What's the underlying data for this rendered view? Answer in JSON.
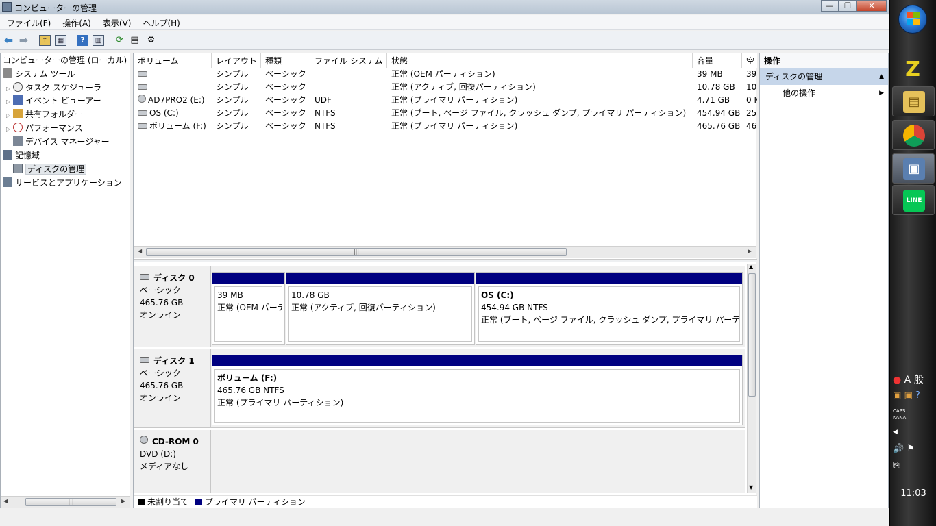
{
  "window": {
    "title": "コンピューターの管理",
    "controls": {
      "minimize": "—",
      "maximize": "❐",
      "close": "✕"
    }
  },
  "menu": [
    "ファイル(F)",
    "操作(A)",
    "表示(V)",
    "ヘルプ(H)"
  ],
  "tree": {
    "root": "コンピューターの管理 (ローカル)",
    "system_tools": "システム ツール",
    "task_scheduler": "タスク スケジューラ",
    "event_viewer": "イベント ビューアー",
    "shared_folders": "共有フォルダー",
    "performance": "パフォーマンス",
    "device_manager": "デバイス マネージャー",
    "storage": "記憶域",
    "disk_management": "ディスクの管理",
    "services_apps": "サービスとアプリケーション"
  },
  "volumes": {
    "columns": [
      "ボリューム",
      "レイアウト",
      "種類",
      "ファイル システム",
      "状態",
      "容量",
      "空"
    ],
    "rows": [
      {
        "name": "",
        "layout": "シンプル",
        "type": "ベーシック",
        "fs": "",
        "status": "正常 (OEM パーティション)",
        "capacity": "39 MB",
        "free": "39"
      },
      {
        "name": "",
        "layout": "シンプル",
        "type": "ベーシック",
        "fs": "",
        "status": "正常 (アクティブ, 回復パーティション)",
        "capacity": "10.78 GB",
        "free": "10"
      },
      {
        "name": "AD7PRO2 (E:)",
        "layout": "シンプル",
        "type": "ベーシック",
        "fs": "UDF",
        "status": "正常 (プライマリ パーティション)",
        "capacity": "4.71 GB",
        "free": "0 M"
      },
      {
        "name": "OS (C:)",
        "layout": "シンプル",
        "type": "ベーシック",
        "fs": "NTFS",
        "status": "正常 (ブート, ページ ファイル, クラッシュ ダンプ, プライマリ パーティション)",
        "capacity": "454.94 GB",
        "free": "25"
      },
      {
        "name": "ボリューム (F:)",
        "layout": "シンプル",
        "type": "ベーシック",
        "fs": "NTFS",
        "status": "正常 (プライマリ パーティション)",
        "capacity": "465.76 GB",
        "free": "46"
      }
    ]
  },
  "disks": [
    {
      "name": "ディスク 0",
      "kind": "ベーシック",
      "size": "465.76 GB",
      "state": "オンライン",
      "partitions": [
        {
          "title": "",
          "line1": "39 MB",
          "line2": "正常 (OEM パーテ"
        },
        {
          "title": "",
          "line1": "10.78 GB",
          "line2": "正常 (アクティブ, 回復パーティション)"
        },
        {
          "title": "OS  (C:)",
          "line1": "454.94 GB NTFS",
          "line2": "正常 (ブート, ページ ファイル, クラッシュ ダンプ, プライマリ パーテ"
        }
      ]
    },
    {
      "name": "ディスク 1",
      "kind": "ベーシック",
      "size": "465.76 GB",
      "state": "オンライン",
      "partitions": [
        {
          "title": "ボリューム  (F:)",
          "line1": "465.76 GB NTFS",
          "line2": "正常 (プライマリ パーティション)"
        }
      ]
    },
    {
      "name": "CD-ROM 0",
      "kind": "DVD (D:)",
      "size": "",
      "state": "メディアなし"
    }
  ],
  "legend": {
    "unallocated": "未割り当て",
    "primary": "プライマリ パーティション",
    "unallocated_color": "#000000",
    "primary_color": "#000080"
  },
  "actions": {
    "header": "操作",
    "section": "ディスクの管理",
    "other": "他の操作"
  },
  "taskbar": {
    "tray_ime": "A 般",
    "caps": "CAPS",
    "kana": "KANA",
    "clock": "11:03",
    "line_label": "LINE"
  }
}
